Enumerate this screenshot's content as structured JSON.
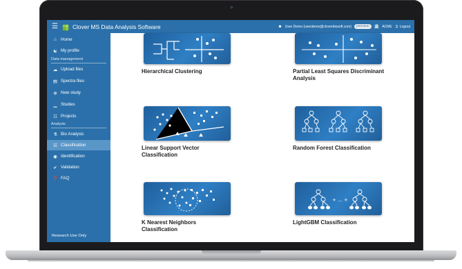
{
  "app": {
    "title": "Clover MS Data Analysis Software",
    "menu_icon": "hamburger-icon",
    "logo_icon": "clover-leaf-icon",
    "accent_color": "#2b70aa"
  },
  "topbar": {
    "user_label": "User Demo (userdemo@cloverbiosoft.com)",
    "badge": "premium",
    "org": "ACME",
    "logout": "Logout"
  },
  "sidebar": {
    "items": [
      {
        "label": "Home",
        "icon": "home-icon"
      },
      {
        "label": "My profile",
        "icon": "users-icon"
      },
      {
        "label": "Upload files",
        "icon": "cloud-upload-icon"
      },
      {
        "label": "Spectra files",
        "icon": "file-icon"
      },
      {
        "label": "New study",
        "icon": "plus-circle-icon"
      },
      {
        "label": "Studies",
        "icon": "chart-icon"
      },
      {
        "label": "Projects",
        "icon": "sitemap-icon"
      },
      {
        "label": "Bio Analysis",
        "icon": "flask-icon"
      },
      {
        "label": "Classification",
        "icon": "hierarchy-icon"
      },
      {
        "label": "Identification",
        "icon": "fingerprint-icon"
      },
      {
        "label": "Validation",
        "icon": "check-icon"
      },
      {
        "label": "FAQ",
        "icon": "question-circle-icon"
      }
    ],
    "sections": {
      "data_management": "Data management",
      "analysis": "Analysis"
    },
    "active": "Classification",
    "footer": "Research Use Only"
  },
  "cards": [
    {
      "title": "Hierarchical Clustering",
      "icon": "dendrogram-icon"
    },
    {
      "title": "Partial Least Squares Discriminant Analysis",
      "icon": "scatter-plot-icon"
    },
    {
      "title": "Linear Support Vector Classification",
      "icon": "svm-icon"
    },
    {
      "title": "Random Forest Classification",
      "icon": "random-forest-icon"
    },
    {
      "title": "K Nearest Neighbors Classification",
      "icon": "knn-icon"
    },
    {
      "title": "LightGBM Classification",
      "icon": "gradient-boosting-icon"
    }
  ]
}
